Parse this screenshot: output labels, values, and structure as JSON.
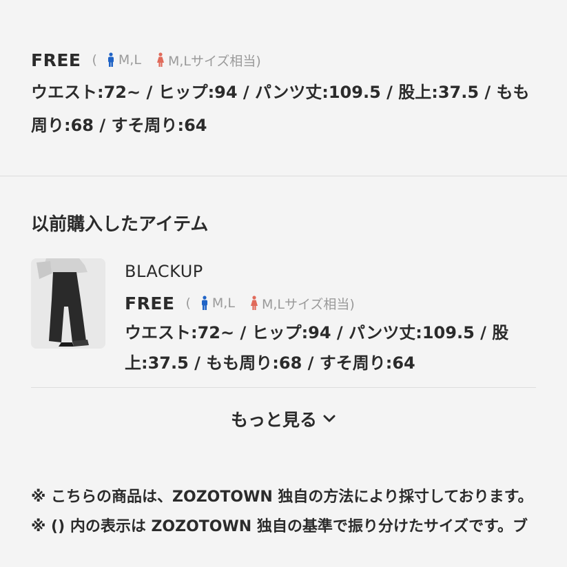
{
  "size_block": {
    "size_name": "FREE",
    "paren_open": "(",
    "male_fit": "M,L",
    "female_fit": "M,Lサイズ相当)",
    "measurements": "ウエスト:72~ / ヒップ:94 / パンツ丈:109.5 / 股上:37.5 / もも周り:68 / すそ周り:64"
  },
  "section_title": "以前購入したアイテム",
  "purchased_item": {
    "brand": "BLACKUP",
    "size_name": "FREE",
    "paren_open": "(",
    "male_fit": "M,L",
    "female_fit": "M,Lサイズ相当)",
    "measurements": "ウエスト:72~ / ヒップ:94 / パンツ丈:109.5 / 股上:37.5 / もも周り:68 / すそ周り:64"
  },
  "more_button": {
    "label": "もっと見る"
  },
  "notes": [
    "※ こちらの商品は、ZOZOTOWN 独自の方法により採寸しております。",
    "※ () 内の表示は ZOZOTOWN 独自の基準で振り分けたサイズです。ブ"
  ],
  "colors": {
    "male_icon": "#1f63c6",
    "female_icon": "#e06a5a",
    "text": "#2b2b2b",
    "muted": "#9a9a9a"
  },
  "icons": {
    "male": "male-figure-icon",
    "female": "female-figure-icon",
    "expand": "chevron-down-icon"
  }
}
